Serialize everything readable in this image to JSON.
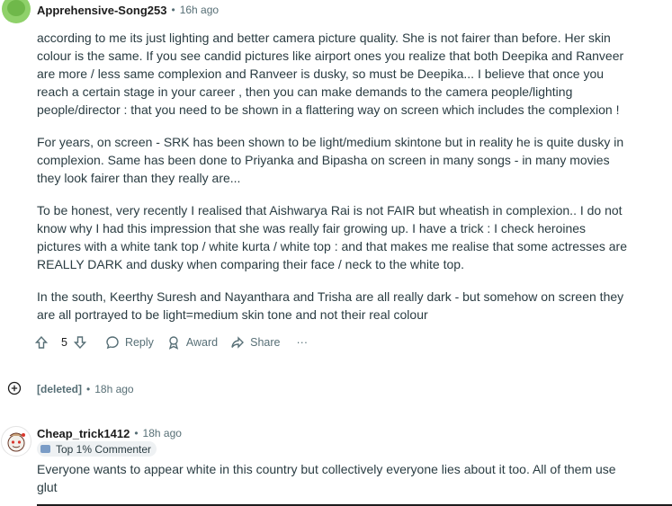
{
  "comment1": {
    "username": "Apprehensive-Song253",
    "time": "16h ago",
    "paragraphs": [
      "according to me its just lighting and better camera picture quality. She is not fairer than before. Her skin colour is the same. If you see candid pictures like airport ones you realize that both Deepika and Ranveer are more / less same complexion and Ranveer is dusky, so must be Deepika... I believe that once you reach a certain stage in your career , then you can make demands to the camera people/lighting people/director : that you need to be shown in a flattering way on screen which includes the complexion !",
      "For years, on screen - SRK has been shown to be light/medium skintone but in reality he is quite dusky in complexion. Same has been done to Priyanka and Bipasha on screen in many songs - in many movies they look fairer than they really are...",
      "To be honest, very recently I realised that Aishwarya Rai is not FAIR but wheatish in complexion.. I do not know why I had this impression that she was really fair growing up. I have a trick : I check heroines pictures with a white tank top / white kurta / white top : and that makes me realise that some actresses are REALLY DARK and dusky when comparing their face / neck to the white top.",
      "In the south, Keerthy Suresh and Nayanthara and Trisha are all really dark - but somehow on screen they are all portrayed to be light=medium skin tone and not their real colour"
    ],
    "votes": "5",
    "actions": {
      "reply": "Reply",
      "award": "Award",
      "share": "Share",
      "more": "···"
    }
  },
  "comment2": {
    "username": "[deleted]",
    "time": "18h ago"
  },
  "comment3": {
    "username": "Cheap_trick1412",
    "time": "18h ago",
    "badge": "Top 1% Commenter",
    "text": "Everyone wants to appear white in this country but collectively everyone lies about it too. All of them use glut"
  },
  "icons": {
    "upvote": "arrow-up-icon",
    "downvote": "arrow-down-icon",
    "reply": "comment-bubble-icon",
    "award": "award-ribbon-icon",
    "share": "share-arrow-icon",
    "expand": "plus-circle-icon"
  }
}
